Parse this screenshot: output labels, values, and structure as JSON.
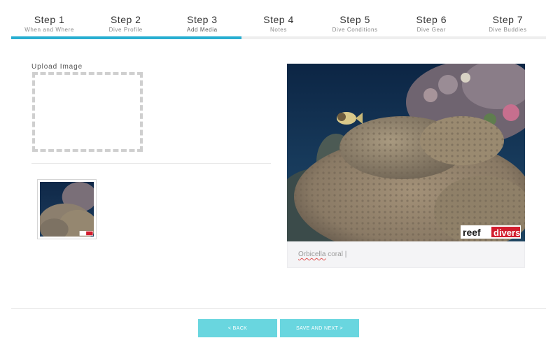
{
  "stepper": {
    "active_index": 2,
    "progress": 0.43,
    "accent_color": "#28aed1",
    "steps": [
      {
        "title": "Step 1",
        "subtitle": "When and Where"
      },
      {
        "title": "Step 2",
        "subtitle": "Dive Profile"
      },
      {
        "title": "Step 3",
        "subtitle": "Add Media"
      },
      {
        "title": "Step 4",
        "subtitle": "Notes"
      },
      {
        "title": "Step 5",
        "subtitle": "Dive Conditions"
      },
      {
        "title": "Step 6",
        "subtitle": "Dive Gear"
      },
      {
        "title": "Step 7",
        "subtitle": "Dive Buddies"
      }
    ]
  },
  "upload": {
    "label": "Upload Image"
  },
  "media": {
    "watermark": "reef divers",
    "caption": {
      "misspelled_word": "Orbicella",
      "rest": " coral |"
    }
  },
  "footer": {
    "back_label": "< BACK",
    "next_label": "SAVE AND NEXT >",
    "button_color": "#69d6df"
  }
}
